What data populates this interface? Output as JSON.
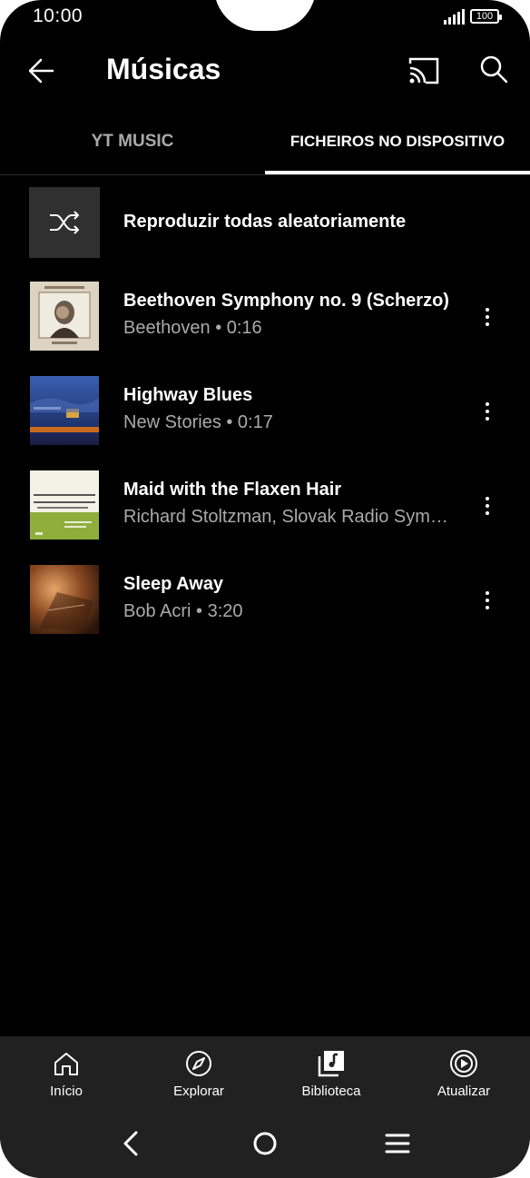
{
  "status": {
    "time": "10:00",
    "battery": "100"
  },
  "header": {
    "title": "Músicas",
    "back_icon": "arrow-left-icon",
    "cast_icon": "cast-icon",
    "search_icon": "search-icon"
  },
  "tabs": [
    {
      "label": "YT MUSIC",
      "active": false
    },
    {
      "label": "FICHEIROS NO DISPOSITIVO",
      "active": true
    }
  ],
  "shuffle": {
    "label": "Reproduzir todas aleatoriamente",
    "icon": "shuffle-icon"
  },
  "songs": [
    {
      "title": "Beethoven Symphony no. 9 (Scherzo)",
      "subtitle": "Beethoven • 0:16"
    },
    {
      "title": "Highway Blues",
      "subtitle": "New Stories • 0:17"
    },
    {
      "title": "Maid with the Flaxen Hair",
      "subtitle": "Richard Stoltzman, Slovak Radio Sym…"
    },
    {
      "title": "Sleep Away",
      "subtitle": "Bob Acri • 3:20"
    }
  ],
  "bottom_nav": [
    {
      "label": "Início",
      "icon": "home-icon"
    },
    {
      "label": "Explorar",
      "icon": "compass-icon"
    },
    {
      "label": "Biblioteca",
      "icon": "library-icon"
    },
    {
      "label": "Atualizar",
      "icon": "upgrade-icon"
    }
  ],
  "system_nav": {
    "back": "system-back-icon",
    "home": "system-home-icon",
    "menu": "system-menu-icon"
  },
  "colors": {
    "background": "#000000",
    "nav_background": "#212121",
    "secondary_text": "#aaaaaa"
  }
}
